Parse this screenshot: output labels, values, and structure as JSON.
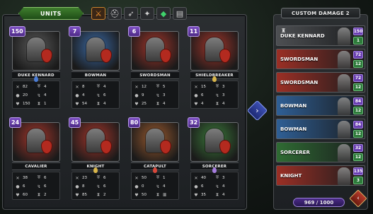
{
  "header": {
    "units_label": "UNITS"
  },
  "filters": [
    {
      "icon": "crossed-swords-icon",
      "glyph": "⚔",
      "active": true
    },
    {
      "icon": "helmet-icon",
      "glyph": "⛑",
      "active": false
    },
    {
      "icon": "bow-icon",
      "glyph": "➶",
      "active": false
    },
    {
      "icon": "spear-icon",
      "glyph": "✦",
      "active": false
    },
    {
      "icon": "gem-icon",
      "glyph": "◆",
      "active": false
    },
    {
      "icon": "wagon-icon",
      "glyph": "▤",
      "active": false
    }
  ],
  "units": [
    {
      "name": "DUKE KENNARD",
      "count": "150",
      "bg": "#5a5a5a",
      "gem": "#4a7cd6",
      "stats": [
        "82",
        "4",
        "20",
        "4",
        "150",
        "1"
      ]
    },
    {
      "name": "BOWMAN",
      "count": "7",
      "bg": "#3b6aa6",
      "gem": "",
      "stats": [
        "8",
        "4",
        "4",
        "6",
        "54",
        "4"
      ]
    },
    {
      "name": "SWORDSMAN",
      "count": "6",
      "bg": "#a5352a",
      "gem": "",
      "stats": [
        "12",
        "5",
        "9",
        "3",
        "25",
        "4"
      ]
    },
    {
      "name": "SHIELDBREAKER",
      "count": "11",
      "bg": "#a5352a",
      "gem": "#d9b64a",
      "stats": [
        "15",
        "3",
        "6",
        "3",
        "4",
        "4"
      ]
    },
    {
      "name": "CAVALIER",
      "count": "24",
      "bg": "#a5352a",
      "gem": "",
      "stats": [
        "38",
        "6",
        "6",
        "6",
        "60",
        "2"
      ]
    },
    {
      "name": "KNIGHT",
      "count": "45",
      "bg": "#a5352a",
      "gem": "#d9b64a",
      "stats": [
        "23",
        "6",
        "8",
        "6",
        "85",
        "2"
      ]
    },
    {
      "name": "CATAPULT",
      "count": "80",
      "bg": "#9b5a2e",
      "gem": "#d9473a",
      "stats": [
        "50",
        "1",
        "0",
        "4",
        "50",
        "▥"
      ]
    },
    {
      "name": "SORCERER",
      "count": "32",
      "bg": "#3b7a3a",
      "gem": "#a67de0",
      "stats": [
        "40",
        "3",
        "6",
        "4",
        "35",
        "4"
      ]
    }
  ],
  "side_panel": {
    "title": "CUSTOM DAMAGE 2",
    "rows": [
      {
        "name": "DUKE KENNARD",
        "top": "150",
        "bottom": "1",
        "bg": "#4d4f52"
      },
      {
        "name": "SWORDSMAN",
        "top": "72",
        "bottom": "12",
        "bg": "#9b2f25"
      },
      {
        "name": "SWORDSMAN",
        "top": "72",
        "bottom": "12",
        "bg": "#9b2f25"
      },
      {
        "name": "BOWMAN",
        "top": "84",
        "bottom": "12",
        "bg": "#2f5f95"
      },
      {
        "name": "BOWMAN",
        "top": "84",
        "bottom": "12",
        "bg": "#2f5f95"
      },
      {
        "name": "SORCERER",
        "top": "32",
        "bottom": "12",
        "bg": "#2f6b33"
      },
      {
        "name": "KNIGHT",
        "top": "135",
        "bottom": "3",
        "bg": "#9b2f25"
      }
    ],
    "capacity": "969 / 1000"
  }
}
